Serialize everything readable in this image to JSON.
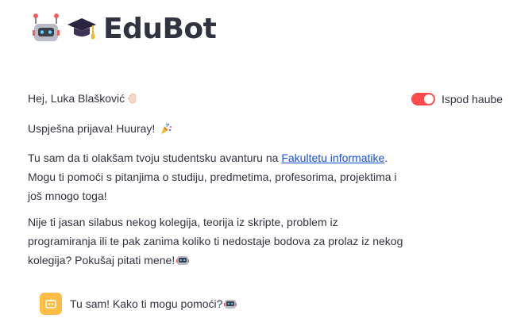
{
  "header": {
    "icons": [
      "robot-emoji",
      "graduation-cap-emoji"
    ],
    "title": "EduBot"
  },
  "greeting": {
    "text": "Hej, Luka Blašković",
    "icon": "waving-hand-emoji"
  },
  "success": {
    "text": "Uspješna prijava! Huuray!",
    "icon": "party-popper-emoji"
  },
  "intro": {
    "before": "Tu sam da ti olakšam tvoju studentsku avanturu na ",
    "link": "Fakultetu informatike",
    "after": ". Mogu ti pomoći s pitanjima o studiju, predmetima, profesorima, projektima i još mnogo toga!"
  },
  "offer": {
    "text": "Nije ti jasan silabus nekog kolegija, teorija iz skripte, problem iz programiranja ili te pak zanima koliko ti nedostaje bodova za prolaz iz nekog kolegija? Pokušaj pitati mene!",
    "icon": "robot-emoji"
  },
  "toggle": {
    "label": "Ispod haube",
    "state": "on",
    "color": "#ff4b4b"
  },
  "chat": {
    "avatar": "bot-icon",
    "avatar_color": "#ffbd45",
    "message": "Tu sam! Kako ti mogu pomoći?",
    "icon": "robot-emoji"
  }
}
